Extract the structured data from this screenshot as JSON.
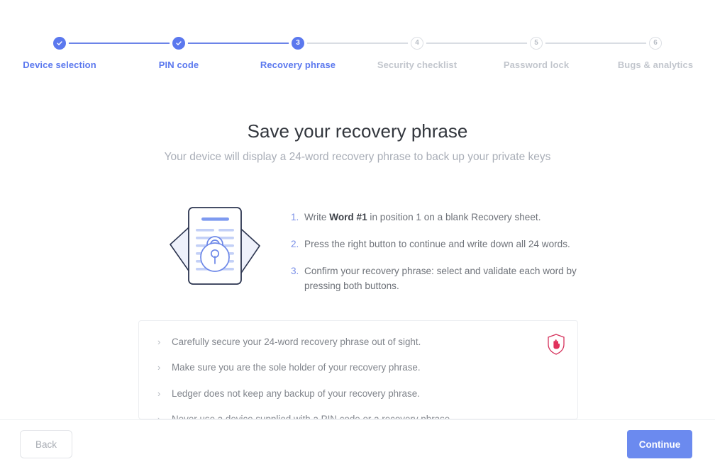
{
  "stepper": {
    "steps": [
      {
        "label": "Device selection",
        "marker": "check",
        "state": "done"
      },
      {
        "label": "PIN code",
        "marker": "check",
        "state": "done"
      },
      {
        "label": "Recovery phrase",
        "marker": "3",
        "state": "current"
      },
      {
        "label": "Security checklist",
        "marker": "4",
        "state": "upcoming"
      },
      {
        "label": "Password lock",
        "marker": "5",
        "state": "upcoming"
      },
      {
        "label": "Bugs & analytics",
        "marker": "6",
        "state": "upcoming"
      }
    ]
  },
  "header": {
    "title": "Save your recovery phrase",
    "subtitle": "Your device will display a 24-word recovery phrase to back up your private keys"
  },
  "instructions": {
    "items": [
      {
        "number": "1.",
        "prefix": "Write ",
        "strong": "Word #1",
        "suffix": " in position 1 on a blank Recovery sheet."
      },
      {
        "number": "2.",
        "prefix": "Press the right button to continue and write down all 24 words.",
        "strong": "",
        "suffix": ""
      },
      {
        "number": "3.",
        "prefix": "Confirm your recovery phrase: select and validate each word by pressing both buttons.",
        "strong": "",
        "suffix": ""
      }
    ]
  },
  "warning_panel": {
    "icon": "shield-stop-hand-icon",
    "icon_color": "#d6325c",
    "chevron": "›",
    "bullets": [
      "Carefully secure your 24-word recovery phrase out of sight.",
      "Make sure you are the sole holder of your recovery phrase.",
      "Ledger does not keep any backup of your recovery phrase.",
      "Never use a device supplied with a PIN code or a recovery phrase."
    ]
  },
  "illustration": {
    "name": "recovery-sheet-lock-illustration"
  },
  "footer": {
    "back_label": "Back",
    "continue_label": "Continue"
  },
  "colors": {
    "accent_blue": "#5b78ee",
    "button_blue": "#6b8aef",
    "muted_gray": "#a9aeb7",
    "danger_red": "#d6325c"
  }
}
